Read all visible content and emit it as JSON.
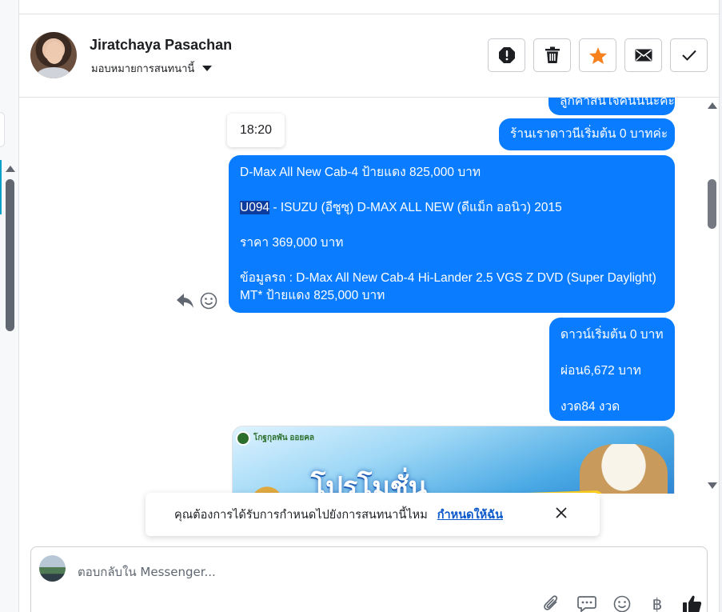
{
  "header": {
    "contact_name": "Jiratchaya Pasachan",
    "assign_label": "มอบหมายการสนทนานี้"
  },
  "actions": [
    {
      "name": "mark-spam",
      "icon": "alert-icon"
    },
    {
      "name": "delete",
      "icon": "trash-icon"
    },
    {
      "name": "star",
      "icon": "star-icon",
      "color": "#f5821f"
    },
    {
      "name": "mark-unread",
      "icon": "envelope-icon"
    },
    {
      "name": "mark-done",
      "icon": "check-icon"
    }
  ],
  "messages": {
    "cut_off": "ลูกค้าสินใจคนนี้นะคะ",
    "down_payment_intro": "ร้านเราดาวนีเริ่มต้น 0 บาทค่ะ",
    "timestamp": "18:20",
    "car_title": "D-Max All New Cab-4 ป้ายแดง 825,000 บาท",
    "car_code": "U094",
    "car_model": " - ISUZU (อีซูซุ) D-MAX ALL NEW (ดีแม็ก ออนิว) 2015",
    "car_price": "ราคา 369,000 บาท",
    "car_detail": "ข้อมูลรถ : D-Max All New Cab-4 Hi-Lander 2.5 VGS Z DVD (Super Daylight) MT* ป้ายแดง 825,000 บาท",
    "pay_down": "ดาวน์เริ่มต้น 0 บาท",
    "pay_monthly": "ผ่อน6,672 บาท",
    "pay_terms": "งวด84 งวด",
    "promo_brand": "โกฐกุลพัน ออยคล",
    "promo_headline": "โปรโมชั่น"
  },
  "toast": {
    "text": "คุณต้องการได้รับการกำหนดไปยังการสนทนานี้ไหม",
    "link": "กำหนดให้ฉัน"
  },
  "composer": {
    "placeholder": "ตอบกลับใน Messenger..."
  },
  "colors": {
    "bubble": "#0a7cff",
    "highlight": "#0d3b9e",
    "star": "#f5821f",
    "link": "#0a58ca"
  }
}
